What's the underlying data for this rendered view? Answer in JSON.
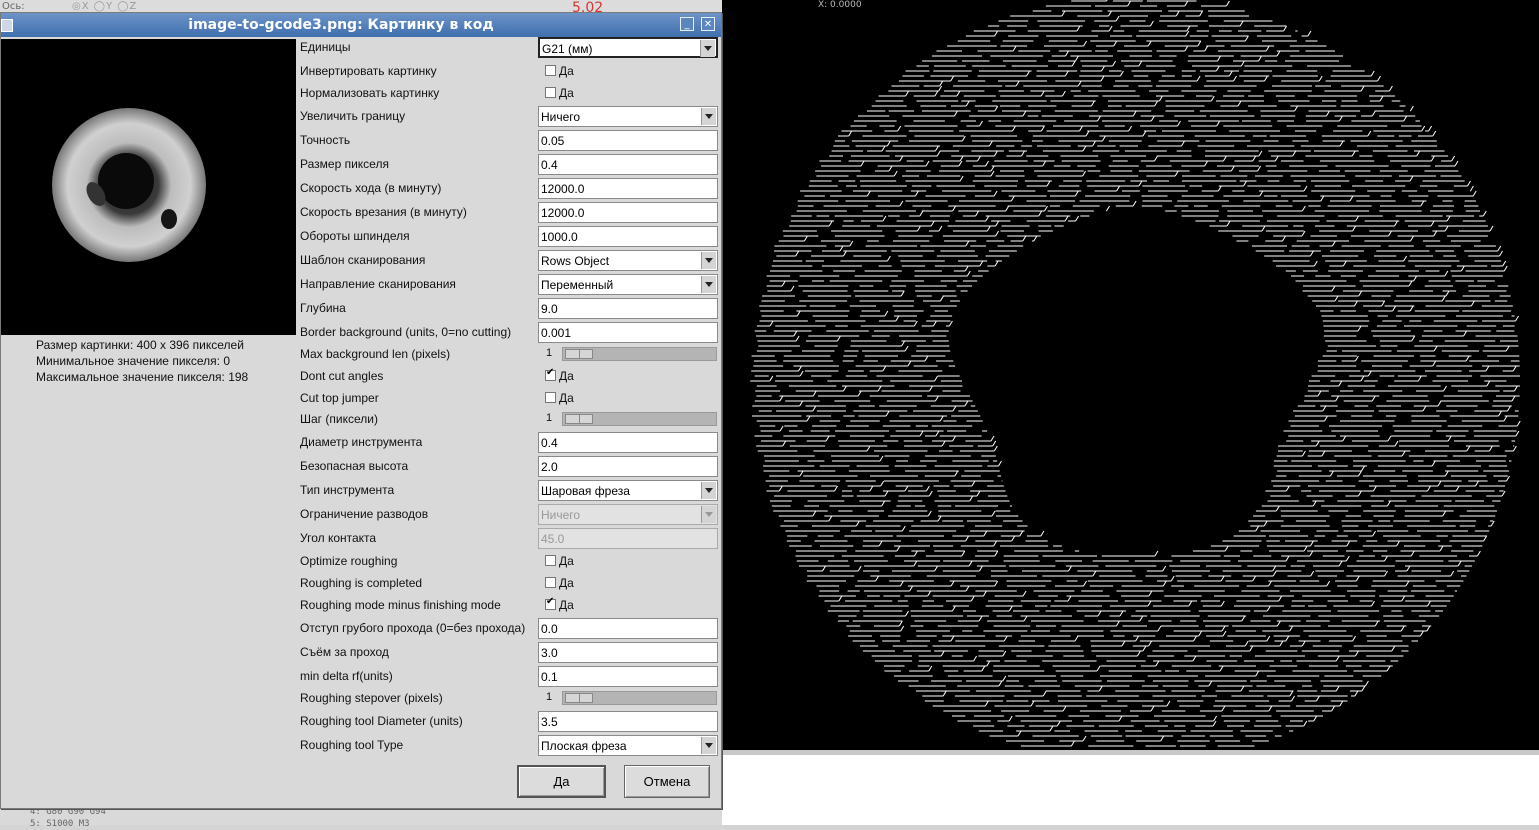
{
  "background": {
    "axis_label": "Ось:",
    "axis_options": "◎X ◯Y ◯Z",
    "dro_text": "X:  0.0000",
    "red_digits": "5.02",
    "gcode_lines": [
      "4: G80 G90 G94",
      "5: S1000 M3"
    ]
  },
  "dialog": {
    "title": "image-to-gcode3.png: Картинку в код",
    "minimize": "_",
    "close": "✕",
    "image_info": {
      "size": "Размер картинки: 400 x 396 пикселей",
      "min_pixel": "Минимальное значение пикселя: 0",
      "max_pixel": "Максимальное значение пикселя: 198"
    },
    "fields": {
      "units": {
        "label": "Единицы",
        "value": "G21 (мм)"
      },
      "invert": {
        "label": "Инвертировать картинку",
        "check": "Да",
        "checked": false
      },
      "normalize": {
        "label": "Нормализовать картинку",
        "check": "Да",
        "checked": false
      },
      "expand": {
        "label": "Увеличить границу",
        "value": "Ничего"
      },
      "tolerance": {
        "label": "Точность",
        "value": "0.05"
      },
      "pixel_size": {
        "label": "Размер пикселя",
        "value": "0.4"
      },
      "feed_rate": {
        "label": "Скорость хода (в минуту)",
        "value": "12000.0"
      },
      "plunge_rate": {
        "label": "Скорость врезания (в минуту)",
        "value": "12000.0"
      },
      "spindle": {
        "label": "Обороты шпинделя",
        "value": "1000.0"
      },
      "scan_pattern": {
        "label": "Шаблон сканирования",
        "value": "Rows Object"
      },
      "scan_direction": {
        "label": "Направление сканирования",
        "value": "Переменный"
      },
      "depth": {
        "label": "Глубина",
        "value": "9.0"
      },
      "border_bg": {
        "label": "Border background (units, 0=no cutting)",
        "value": "0.001"
      },
      "max_bg_len": {
        "label": "Max background len (pixels)",
        "value": "1",
        "level": 0
      },
      "dont_cut_angles": {
        "label": "Dont cut angles",
        "check": "Да",
        "checked": true
      },
      "cut_top_jumper": {
        "label": "Cut top jumper",
        "check": "Да",
        "checked": false
      },
      "step": {
        "label": "Шаг (пиксели)",
        "value": "1",
        "level": 0
      },
      "tool_diameter": {
        "label": "Диаметр инструмента",
        "value": "0.4"
      },
      "safety_height": {
        "label": "Безопасная высота",
        "value": "2.0"
      },
      "tool_type": {
        "label": "Тип инструмента",
        "value": "Шаровая фреза"
      },
      "bounded": {
        "label": "Ограничение разводов",
        "value": "Ничего",
        "disabled": true
      },
      "contact_angle": {
        "label": "Угол контакта",
        "value": "45.0",
        "disabled": true
      },
      "optimize_roughing": {
        "label": "Optimize roughing",
        "check": "Да",
        "checked": false
      },
      "roughing_completed": {
        "label": "Roughing is completed",
        "check": "Да",
        "checked": false
      },
      "roughing_minus": {
        "label": "Roughing mode minus finishing mode",
        "check": "Да",
        "checked": true
      },
      "roughing_offset": {
        "label": "Отступ грубого прохода (0=без прохода)",
        "value": "0.0"
      },
      "roughing_depth": {
        "label": "Съём за проход",
        "value": "3.0"
      },
      "min_delta_rf": {
        "label": "min delta rf(units)",
        "value": "0.1"
      },
      "roughing_stepover": {
        "label": "Roughing stepover (pixels)",
        "value": "1",
        "level": 0
      },
      "roughing_tool_diameter": {
        "label": "Roughing tool Diameter (units)",
        "value": "3.5"
      },
      "roughing_tool_type": {
        "label": "Roughing tool Type",
        "value": "Плоская фреза"
      }
    },
    "buttons": {
      "ok": "Да",
      "cancel": "Отмена"
    }
  },
  "colors": {
    "titlebar": "#4a78b5",
    "dialog_bg": "#d9d9d9",
    "preview_bg": "#000000",
    "toolpath": "#ffffff"
  }
}
